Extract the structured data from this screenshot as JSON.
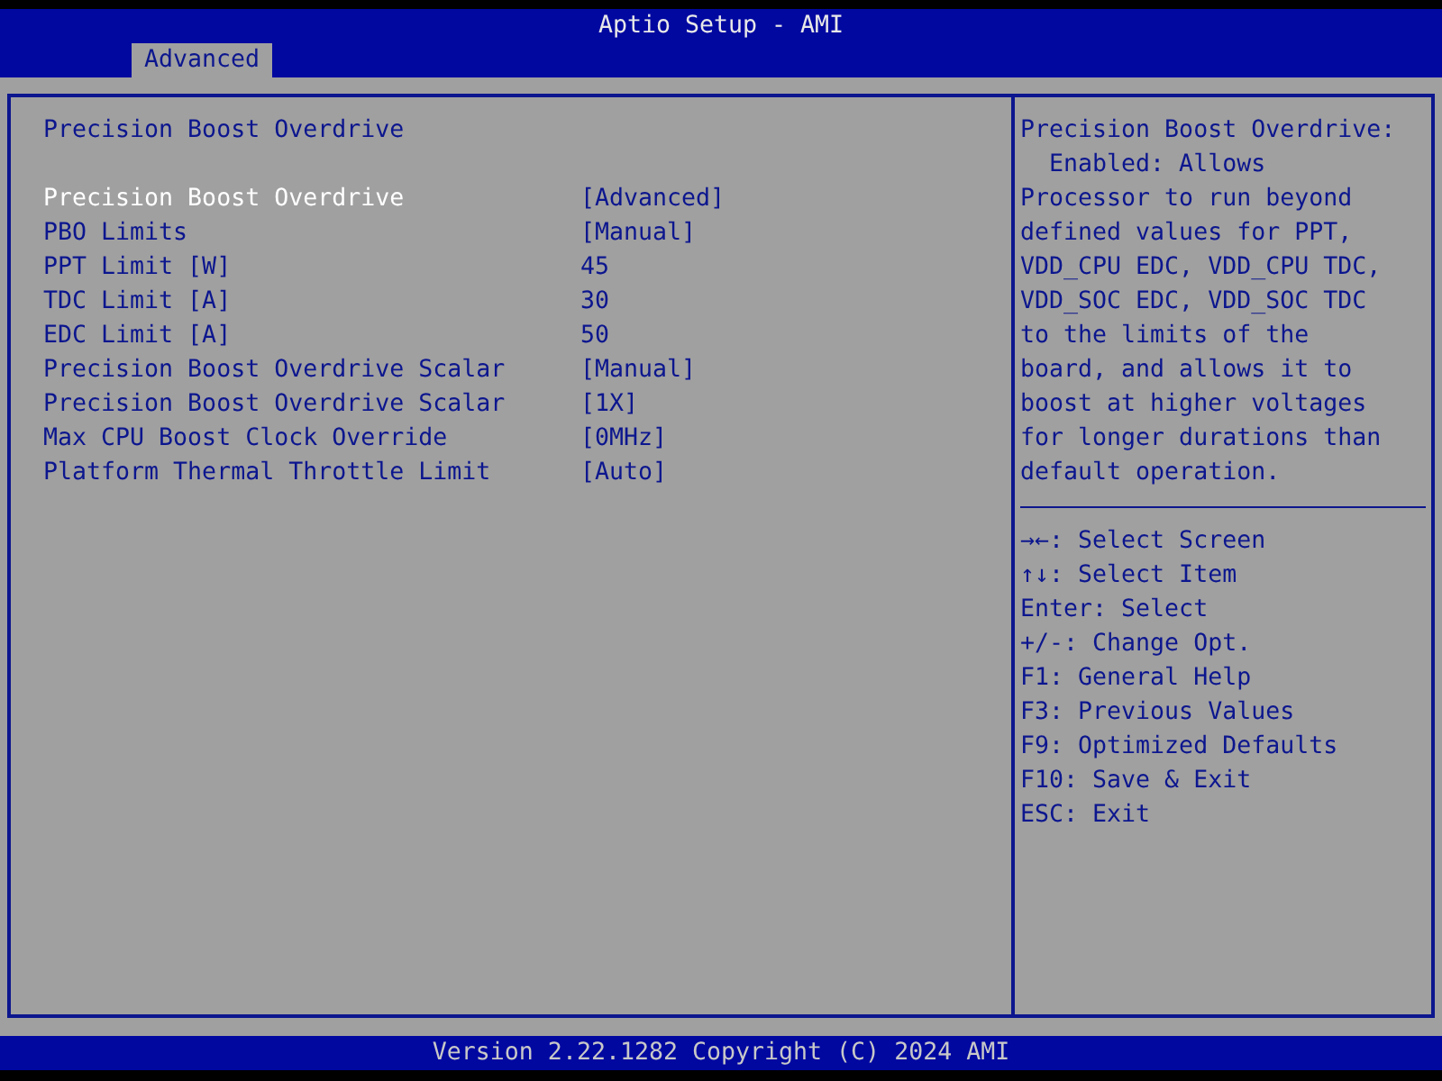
{
  "window": {
    "title": "Aptio Setup - AMI"
  },
  "tabs": [
    {
      "label": "Advanced",
      "selected": true
    }
  ],
  "page": {
    "heading": "Precision Boost Overdrive",
    "settings": [
      {
        "label": "Precision Boost Overdrive",
        "value": "[Advanced]",
        "selected": true
      },
      {
        "label": "PBO Limits",
        "value": "[Manual]",
        "selected": false
      },
      {
        "label": "PPT Limit [W]",
        "value": "45",
        "selected": false
      },
      {
        "label": "TDC Limit [A]",
        "value": "30",
        "selected": false
      },
      {
        "label": "EDC Limit [A]",
        "value": "50",
        "selected": false
      },
      {
        "label": "Precision Boost Overdrive Scalar",
        "value": "[Manual]",
        "selected": false
      },
      {
        "label": "Precision Boost Overdrive Scalar",
        "value": "[1X]",
        "selected": false
      },
      {
        "label": "Max CPU Boost Clock Override",
        "value": "[0MHz]",
        "selected": false
      },
      {
        "label": "Platform Thermal Throttle Limit",
        "value": "[Auto]",
        "selected": false
      }
    ]
  },
  "help": {
    "text": "Precision Boost Overdrive:\n  Enabled: Allows\nProcessor to run beyond\ndefined values for PPT,\nVDD_CPU EDC, VDD_CPU TDC,\nVDD_SOC EDC, VDD_SOC TDC\nto the limits of the\nboard, and allows it to\nboost at higher voltages\nfor longer durations than\ndefault operation.",
    "keys": [
      "→←: Select Screen",
      "↑↓: Select Item",
      "Enter: Select",
      "+/-: Change Opt.",
      "F1: General Help",
      "F3: Previous Values",
      "F9: Optimized Defaults",
      "F10: Save & Exit",
      "ESC: Exit"
    ]
  },
  "status_bar": {
    "text": "Version 2.22.1282 Copyright (C) 2024 AMI"
  }
}
